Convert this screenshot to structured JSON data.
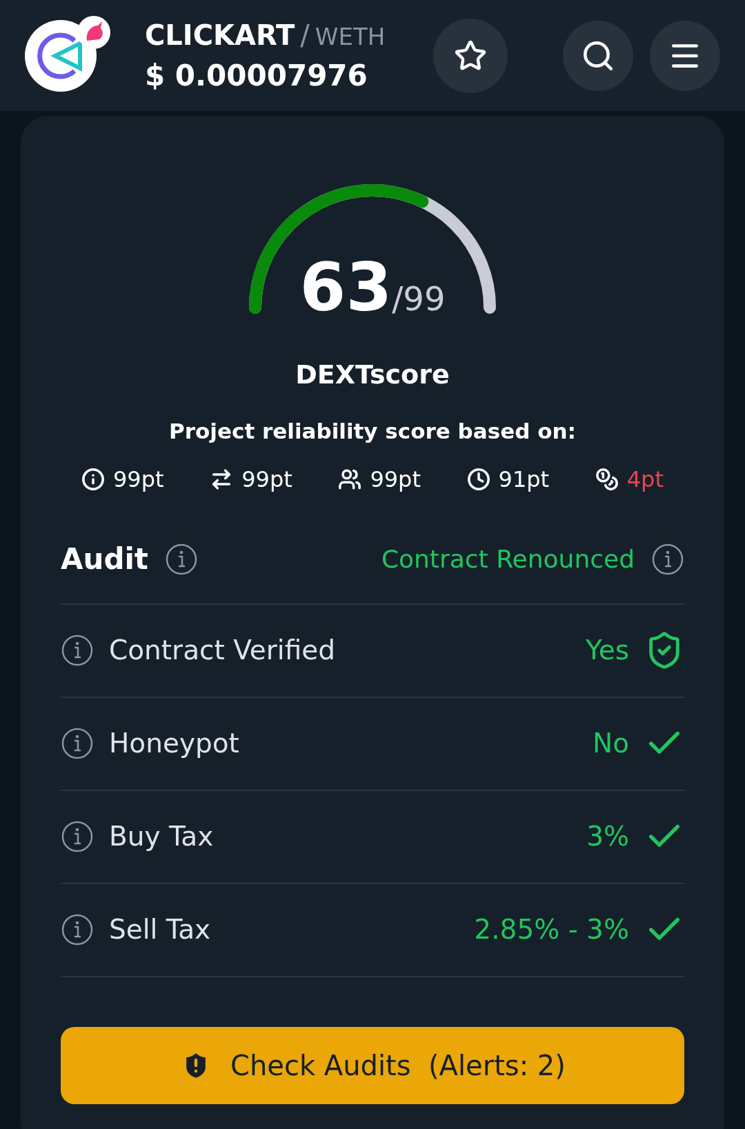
{
  "header": {
    "token": "CLICKART",
    "separator": "/",
    "pair": "WETH",
    "price": "$ 0.00007976"
  },
  "score": {
    "value": "63",
    "max": "/99",
    "label": "DEXTscore",
    "subtitle": "Project reliability score based on:"
  },
  "metrics": [
    {
      "kind": "info",
      "text": "99pt",
      "color": "#ffffff"
    },
    {
      "kind": "transfers",
      "text": "99pt",
      "color": "#ffffff"
    },
    {
      "kind": "holders",
      "text": "99pt",
      "color": "#ffffff"
    },
    {
      "kind": "age",
      "text": "91pt",
      "color": "#ffffff"
    },
    {
      "kind": "liquidity",
      "text": "4pt",
      "color": "#e5484d"
    }
  ],
  "audit": {
    "title": "Audit",
    "status": "Contract Renounced"
  },
  "rows": [
    {
      "label": "Contract Verified",
      "value": "Yes",
      "kind": "shield"
    },
    {
      "label": "Honeypot",
      "value": "No",
      "kind": "check"
    },
    {
      "label": "Buy Tax",
      "value": "3%",
      "kind": "check"
    },
    {
      "label": "Sell Tax",
      "value": "2.85% - 3%",
      "kind": "check"
    }
  ],
  "button": {
    "label": "Check Audits",
    "alerts": "(Alerts: 2)"
  }
}
